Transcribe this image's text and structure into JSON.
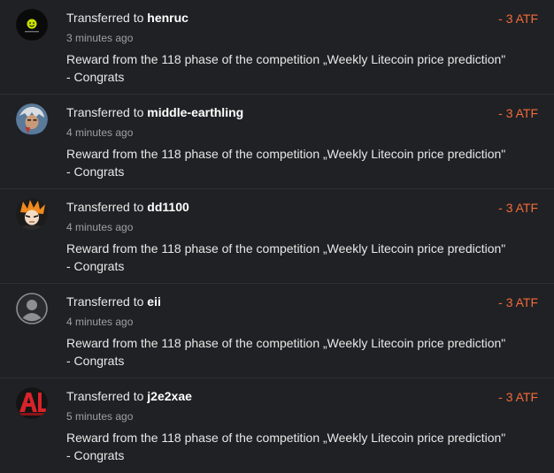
{
  "transactions": [
    {
      "prefix": "Transferred to",
      "user": "henruc",
      "time": "3 minutes ago",
      "message": "Reward from the 118 phase of the competition „Weekly Litecoin price prediction\" - Congrats",
      "amount": "- 3 ATF",
      "avatar": "green-smiley-avatar"
    },
    {
      "prefix": "Transferred to",
      "user": "middle-earthling",
      "time": "4 minutes ago",
      "message": "Reward from the 118 phase of the competition „Weekly Litecoin price prediction\" - Congrats",
      "amount": "- 3 ATF",
      "avatar": "character-avatar"
    },
    {
      "prefix": "Transferred to",
      "user": "dd1100",
      "time": "4 minutes ago",
      "message": "Reward from the 118 phase of the competition „Weekly Litecoin price prediction\" - Congrats",
      "amount": "- 3 ATF",
      "avatar": "anime-character-avatar"
    },
    {
      "prefix": "Transferred to",
      "user": "eii",
      "time": "4 minutes ago",
      "message": "Reward from the 118 phase of the competition „Weekly Litecoin price prediction\" - Congrats",
      "amount": "- 3 ATF",
      "avatar": "default-user-avatar"
    },
    {
      "prefix": "Transferred to",
      "user": "j2e2xae",
      "time": "5 minutes ago",
      "message": "Reward from the 118 phase of the competition „Weekly Litecoin price prediction\" - Congrats",
      "amount": "- 3 ATF",
      "avatar": "red-letter-avatar"
    }
  ],
  "colors": {
    "background": "#202124",
    "amount": "#f26b3a",
    "text": "#e8e8e8",
    "muted": "#9aa0a6"
  }
}
